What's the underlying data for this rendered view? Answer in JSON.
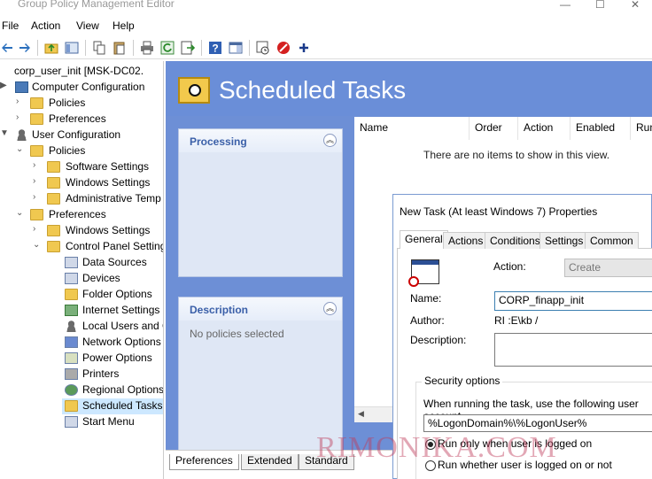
{
  "window": {
    "title": "Group Policy Management Editor",
    "minimize_glyph": "—",
    "maximize_glyph": "☐",
    "close_glyph": "✕"
  },
  "menu": [
    "File",
    "Action",
    "View",
    "Help"
  ],
  "toolbar": {
    "icons": [
      "back-icon",
      "forward-icon",
      "up-folder-icon",
      "show-tree-icon",
      "copy-icon",
      "paste-icon",
      "print-icon",
      "refresh-icon",
      "export-icon",
      "help-icon",
      "show-hide-icon",
      "run-task-icon",
      "stop-icon",
      "add-icon"
    ]
  },
  "tree": {
    "root": "corp_user_init [MSK-DC02.",
    "computer_config": "Computer Configuration",
    "cc_policies": "Policies",
    "cc_preferences": "Preferences",
    "user_config": "User Configuration",
    "uc_policies": "Policies",
    "software_settings": "Software Settings",
    "windows_settings": "Windows Settings",
    "admin_templates": "Administrative Temp",
    "uc_preferences": "Preferences",
    "pref_windows_settings": "Windows Settings",
    "control_panel": "Control Panel Setting",
    "items": [
      "Data Sources",
      "Devices",
      "Folder Options",
      "Internet Settings",
      "Local Users and G",
      "Network Options",
      "Power Options",
      "Printers",
      "Regional Options",
      "Scheduled Tasks",
      "Start Menu"
    ],
    "selected": "Scheduled Tasks"
  },
  "main": {
    "heading": "Scheduled Tasks",
    "processing_title": "Processing",
    "description_title": "Description",
    "description_text": "No policies selected",
    "columns": [
      "Name",
      "Order",
      "Action",
      "Enabled",
      "Run"
    ],
    "empty_text": "There are no items to show in this view.",
    "bottom_tabs": [
      "Preferences",
      "Extended",
      "Standard"
    ],
    "active_bottom_tab": "Preferences"
  },
  "dialog": {
    "title": "New Task (At least Windows 7) Properties",
    "tabs": [
      "General",
      "Actions",
      "Conditions",
      "Settings",
      "Common"
    ],
    "active_tab": "General",
    "action_label": "Action:",
    "action_value": "Create",
    "name_label": "Name:",
    "name_value": "CORP_finapp_init",
    "author_label": "Author:",
    "author_value": "RI         :E\\kb        /",
    "description_label": "Description:",
    "description_value": "",
    "security_title": "Security options",
    "security_text": "When running the task, use the following user account",
    "account_value": "%LogonDomain%\\%LogonUser%",
    "radio_logged_on": "Run only when user is logged on",
    "radio_whether": "Run whether user is logged on or not"
  },
  "watermark": "RIMONIKA.COM",
  "colors": {
    "pane_blue": "#6d8fd6",
    "panel_title": "#3a5fa8",
    "selection": "#cde8ff"
  }
}
